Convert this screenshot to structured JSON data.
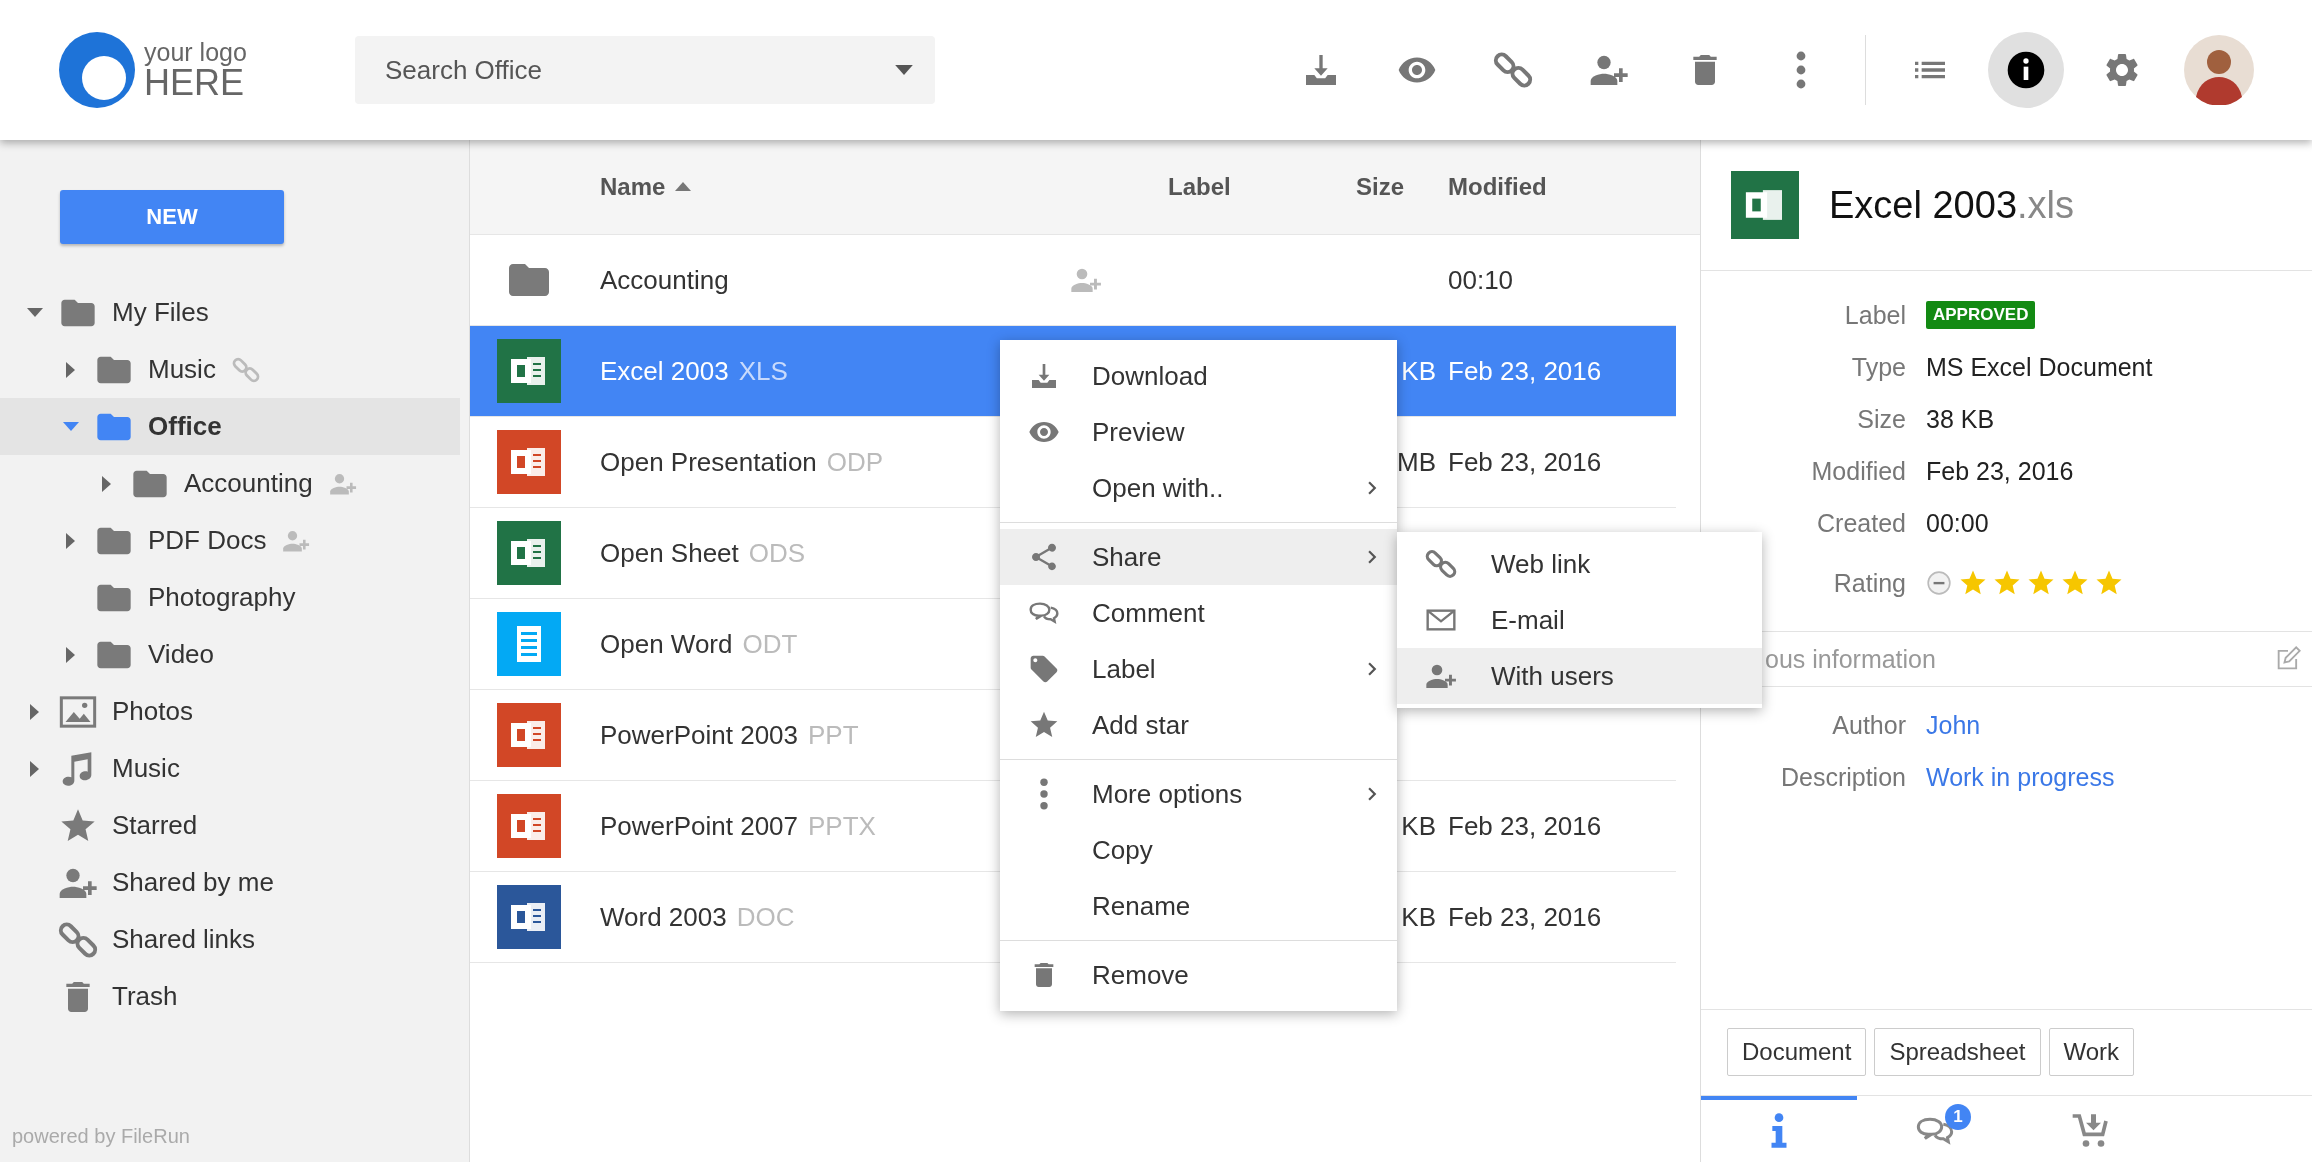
{
  "logo": {
    "line1": "your logo",
    "line2": "HERE"
  },
  "search": {
    "placeholder": "Search Office"
  },
  "toolbar": [
    {
      "kind": "download",
      "selected": false
    },
    {
      "kind": "preview",
      "selected": false
    },
    {
      "kind": "link",
      "selected": false
    },
    {
      "kind": "user",
      "selected": false
    },
    {
      "kind": "trash",
      "selected": false
    },
    {
      "kind": "more",
      "selected": false
    }
  ],
  "view_buttons": [
    {
      "kind": "list",
      "selected": false
    },
    {
      "kind": "info",
      "selected": true
    },
    {
      "kind": "settings",
      "selected": false
    }
  ],
  "sidebar": {
    "new_button": "NEW",
    "tree": [
      {
        "label": "My Files",
        "kind": "folder",
        "expandable": true,
        "expanded": true,
        "selected": false,
        "shared_link": false,
        "shared_users": false,
        "children": [
          {
            "label": "Music",
            "kind": "folder",
            "expandable": true,
            "expanded": false,
            "selected": false,
            "shared_link": true,
            "shared_users": false
          },
          {
            "label": "Office",
            "kind": "folder",
            "expandable": true,
            "expanded": true,
            "selected": true,
            "shared_link": false,
            "shared_users": false,
            "children": [
              {
                "label": "Accounting",
                "kind": "folder",
                "expandable": true,
                "expanded": false,
                "selected": false,
                "shared_link": false,
                "shared_users": true
              }
            ]
          },
          {
            "label": "PDF Docs",
            "kind": "folder",
            "expandable": true,
            "expanded": false,
            "selected": false,
            "shared_link": false,
            "shared_users": true
          },
          {
            "label": "Photography",
            "kind": "folder",
            "expandable": false,
            "selected": false,
            "shared_link": false,
            "shared_users": false
          },
          {
            "label": "Video",
            "kind": "folder",
            "expandable": true,
            "expanded": false,
            "selected": false,
            "shared_link": false,
            "shared_users": false
          }
        ]
      },
      {
        "label": "Photos",
        "kind": "photos",
        "expandable": true,
        "expanded": false,
        "selected": false,
        "shared_link": false,
        "shared_users": false
      },
      {
        "label": "Music",
        "kind": "music",
        "expandable": true,
        "expanded": false,
        "selected": false,
        "shared_link": false,
        "shared_users": false
      },
      {
        "label": "Starred",
        "kind": "star",
        "expandable": false,
        "selected": false,
        "shared_link": false,
        "shared_users": false
      },
      {
        "label": "Shared by me",
        "kind": "user",
        "expandable": false,
        "selected": false,
        "shared_link": false,
        "shared_users": false
      },
      {
        "label": "Shared links",
        "kind": "link",
        "expandable": false,
        "selected": false,
        "shared_link": false,
        "shared_users": false
      },
      {
        "label": "Trash",
        "kind": "trash",
        "expandable": false,
        "selected": false,
        "shared_link": false,
        "shared_users": false
      }
    ],
    "footer": "powered by FileRun"
  },
  "file_list": {
    "columns": [
      {
        "label": "Name",
        "sorted": true
      },
      {
        "label": "Label",
        "sorted": false
      },
      {
        "label": "Size",
        "sorted": false
      },
      {
        "label": "Modified",
        "sorted": false
      }
    ],
    "rows": [
      {
        "kind": "folder",
        "name": "Accounting",
        "shared": true,
        "modified": "00:10",
        "selected": false
      },
      {
        "kind": "excel",
        "name": "Excel 2003",
        "ext": "XLS",
        "shared": false,
        "size": "KB",
        "modified": "Feb 23, 2016",
        "selected": true
      },
      {
        "kind": "powerpoint",
        "name": "Open Presentation",
        "ext": "ODP",
        "size": "MB",
        "modified": "Feb 23, 2016",
        "selected": false
      },
      {
        "kind": "excel",
        "name": "Open Sheet",
        "ext": "ODS",
        "selected": false
      },
      {
        "kind": "document",
        "name": "Open Word",
        "ext": "ODT",
        "selected": false
      },
      {
        "kind": "powerpoint",
        "name": "PowerPoint 2003",
        "ext": "PPT",
        "selected": false
      },
      {
        "kind": "powerpoint",
        "name": "PowerPoint 2007",
        "ext": "PPTX",
        "size": "KB",
        "modified": "Feb 23, 2016",
        "selected": false
      },
      {
        "kind": "word",
        "name": "Word 2003",
        "ext": "DOC",
        "size": "KB",
        "modified": "Feb 23, 2016",
        "selected": false
      }
    ]
  },
  "context_menu": {
    "groups": [
      [
        {
          "kind": "download",
          "label": "Download",
          "submenu": false,
          "highlighted": false
        },
        {
          "kind": "preview",
          "label": "Preview",
          "submenu": false,
          "highlighted": false
        },
        {
          "kind": "plain",
          "label": "Open with..",
          "submenu": true,
          "highlighted": false
        }
      ],
      [
        {
          "kind": "share",
          "label": "Share",
          "submenu": true,
          "highlighted": true
        },
        {
          "kind": "comment",
          "label": "Comment",
          "submenu": false,
          "highlighted": false
        },
        {
          "kind": "tag",
          "label": "Label",
          "submenu": true,
          "highlighted": false
        },
        {
          "kind": "star",
          "label": "Add star",
          "submenu": false,
          "highlighted": false
        }
      ],
      [
        {
          "kind": "more",
          "label": "More options",
          "submenu": true,
          "highlighted": false
        },
        {
          "kind": "plain",
          "label": "Copy",
          "submenu": false,
          "highlighted": false
        },
        {
          "kind": "plain",
          "label": "Rename",
          "submenu": false,
          "highlighted": false
        }
      ],
      [
        {
          "kind": "trash",
          "label": "Remove",
          "submenu": false,
          "highlighted": false
        }
      ]
    ],
    "submenu": [
      {
        "kind": "link",
        "label": "Web link",
        "highlighted": false
      },
      {
        "kind": "mail",
        "label": "E-mail",
        "highlighted": false
      },
      {
        "kind": "user",
        "label": "With users",
        "highlighted": true
      }
    ]
  },
  "details": {
    "kind": "excel",
    "title": "Excel 2003",
    "ext": ".xls",
    "fields": [
      {
        "kind": "badge",
        "label": "Label",
        "value": "APPROVED"
      },
      {
        "kind": "text",
        "label": "Type",
        "value": "MS Excel Document"
      },
      {
        "kind": "text",
        "label": "Size",
        "value": "38 KB"
      },
      {
        "kind": "text",
        "label": "Modified",
        "value": "Feb 23, 2016"
      },
      {
        "kind": "text",
        "label": "Created",
        "value": "00:00"
      },
      {
        "kind": "stars",
        "label": "Rating",
        "stars": 5
      }
    ],
    "section_title": "ous information",
    "info_fields": [
      {
        "kind": "link",
        "label": "Author",
        "value": "John"
      },
      {
        "kind": "link",
        "label": "Description",
        "value": "Work in progress"
      }
    ],
    "tags": [
      "Document",
      "Spreadsheet",
      "Work"
    ],
    "tabs": [
      {
        "kind": "info",
        "selected": true
      },
      {
        "kind": "comment",
        "selected": false,
        "badge": "1"
      },
      {
        "kind": "cart",
        "selected": false
      }
    ]
  }
}
